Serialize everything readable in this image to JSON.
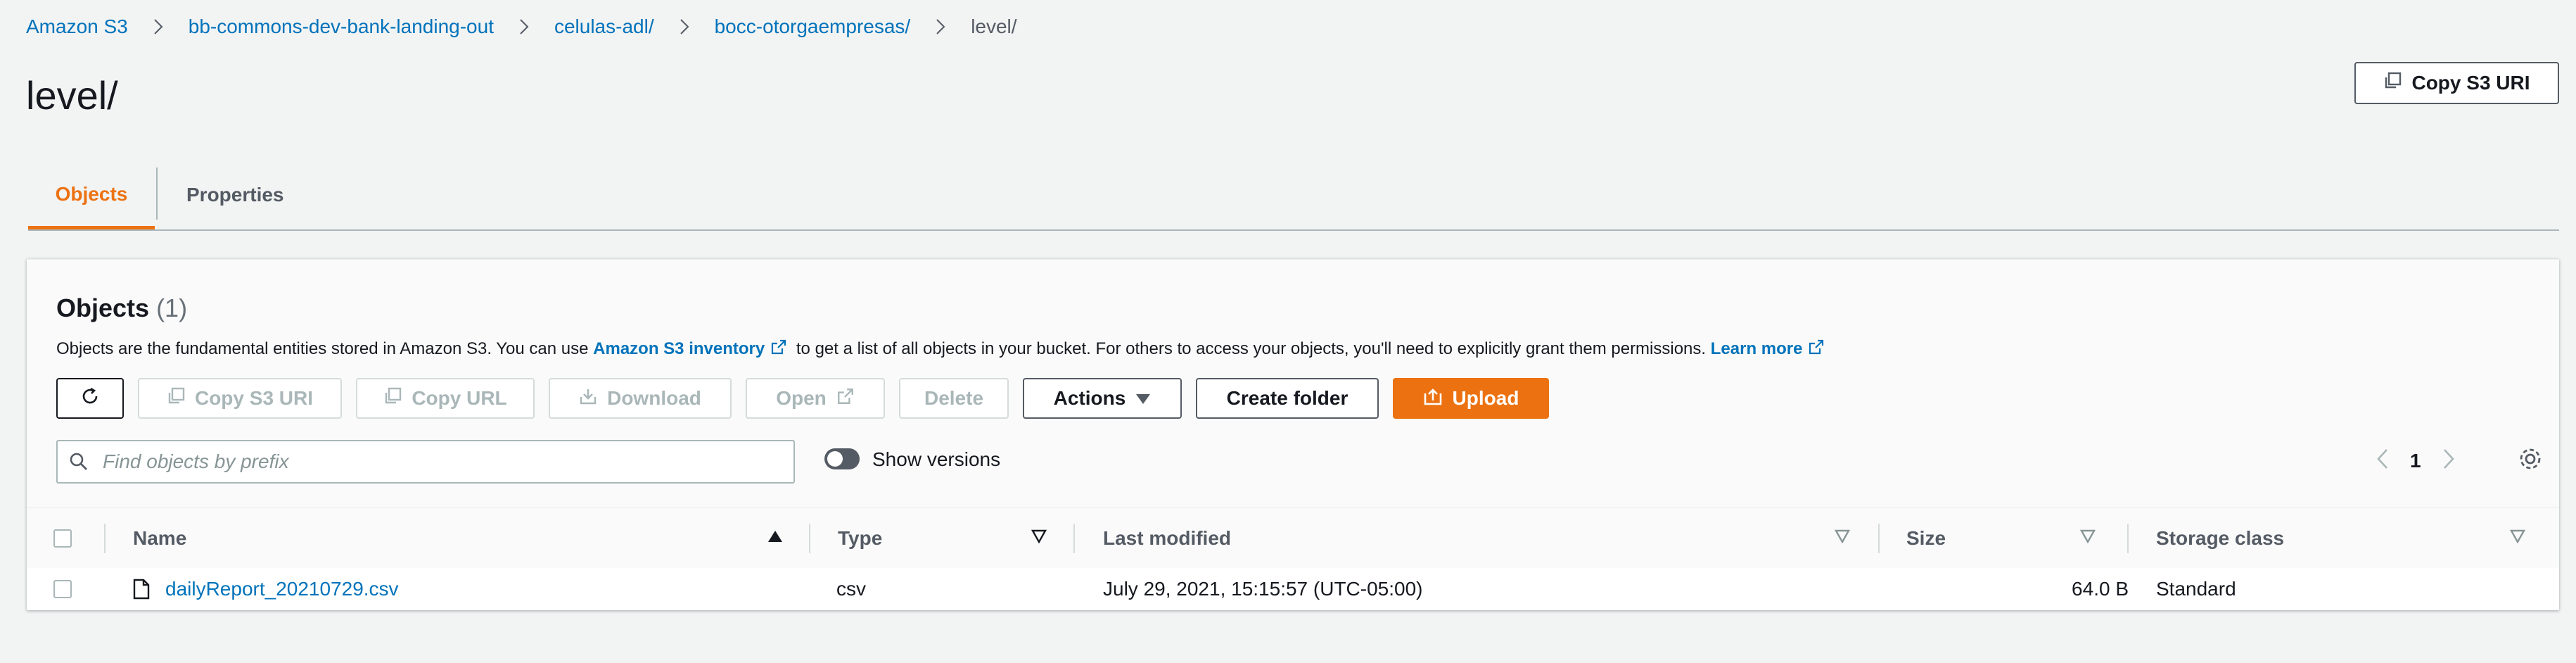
{
  "breadcrumb": [
    {
      "label": "Amazon S3"
    },
    {
      "label": "bb-commons-dev-bank-landing-out"
    },
    {
      "label": "celulas-adl/"
    },
    {
      "label": "bocc-otorgaempresas/"
    },
    {
      "label": "level/"
    }
  ],
  "page": {
    "title": "level/",
    "copy_s3_uri_label": "Copy S3 URI"
  },
  "tabs": [
    {
      "label": "Objects",
      "active": true
    },
    {
      "label": "Properties",
      "active": false
    }
  ],
  "objects_panel": {
    "title": "Objects",
    "count": "(1)",
    "description_pre": "Objects are the fundamental entities stored in Amazon S3. You can use ",
    "inventory_link": "Amazon S3 inventory",
    "description_mid": " to get a list of all objects in your bucket. For others to access your objects, you'll need to explicitly grant them permissions. ",
    "learn_more": "Learn more"
  },
  "toolbar": {
    "copy_s3_uri": "Copy S3 URI",
    "copy_url": "Copy URL",
    "download": "Download",
    "open": "Open",
    "delete": "Delete",
    "actions": "Actions",
    "create_folder": "Create folder",
    "upload": "Upload"
  },
  "search": {
    "placeholder": "Find objects by prefix",
    "value": ""
  },
  "show_versions": {
    "label": "Show versions",
    "enabled": false
  },
  "pagination": {
    "current_page": "1"
  },
  "table": {
    "columns": [
      "Name",
      "Type",
      "Last modified",
      "Size",
      "Storage class"
    ],
    "rows": [
      {
        "name": "dailyReport_20210729.csv",
        "type": "csv",
        "last_modified": "July 29, 2021, 15:15:57 (UTC-05:00)",
        "size": "64.0 B",
        "storage_class": "Standard"
      }
    ]
  },
  "colors": {
    "accent": "#ec7211",
    "link": "#0073bb",
    "background": "#f2f3f3"
  }
}
